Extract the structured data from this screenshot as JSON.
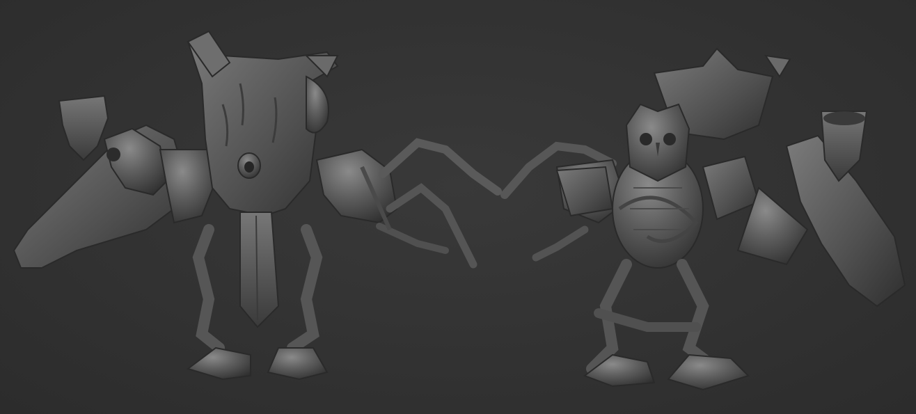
{
  "scene": {
    "background_color": "#323232",
    "material_color": "#5a5a5a",
    "highlight_color": "#8a8a8a",
    "shadow_color": "#2a2a2a",
    "models": [
      {
        "name": "tree-stump-creature-back-view"
      },
      {
        "name": "owl-tree-creature-front-view"
      }
    ]
  }
}
